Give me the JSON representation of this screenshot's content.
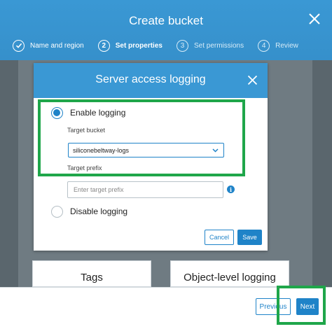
{
  "modal": {
    "title": "Create bucket",
    "steps": [
      {
        "number": "",
        "label": "Name and region",
        "state": "done"
      },
      {
        "number": "2",
        "label": "Set properties",
        "state": "active"
      },
      {
        "number": "3",
        "label": "Set permissions",
        "state": "upcoming"
      },
      {
        "number": "4",
        "label": "Review",
        "state": "upcoming"
      }
    ],
    "icons": {
      "close": "close-icon",
      "done_step": "check-icon"
    }
  },
  "cards": {
    "tags": "Tags",
    "object_level_logging": "Object-level logging"
  },
  "dialog": {
    "title": "Server access logging",
    "enable_label": "Enable logging",
    "enable_selected": true,
    "target_bucket_label": "Target bucket",
    "target_bucket_value": "siliconebeltway-logs",
    "target_prefix_label": "Target prefix",
    "target_prefix_placeholder": "Enter target prefix",
    "target_prefix_value": "",
    "disable_label": "Disable logging",
    "cancel_label": "Cancel",
    "save_label": "Save",
    "info_icon": "info-icon"
  },
  "footer": {
    "previous_label": "Previous",
    "next_label": "Next"
  },
  "colors": {
    "header_blue": "#3a98d4",
    "button_blue": "#1f83c8",
    "highlight_green": "#1fa64a",
    "overlay_gray": "#5a666d"
  }
}
